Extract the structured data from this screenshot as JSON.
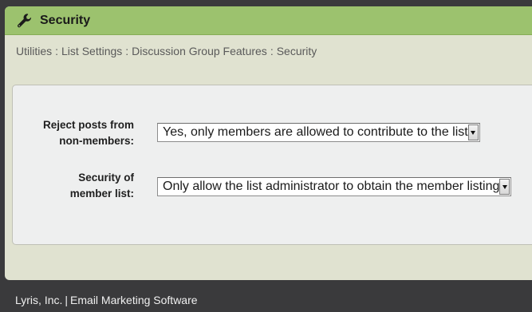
{
  "header": {
    "title": "Security",
    "icon": "wrench-icon"
  },
  "breadcrumb": {
    "items": [
      "Utilities",
      "List Settings",
      "Discussion Group Features",
      "Security"
    ],
    "separator": ":"
  },
  "form": {
    "reject_posts": {
      "label_line1": "Reject posts from",
      "label_line2": "non-members:",
      "selected": "Yes, only members are allowed to contribute to the list"
    },
    "member_list_security": {
      "label_line1": "Security of",
      "label_line2": "member list:",
      "selected": "Only allow the list administrator to obtain the member listing"
    }
  },
  "footer": {
    "company": "Lyris, Inc.",
    "separator": "|",
    "product": "Email Marketing Software"
  },
  "colors": {
    "page_background": "#3a3a3c",
    "title_bar": "#9cc26e",
    "content_background": "#e0e2d0",
    "panel_background": "#eeefef"
  }
}
